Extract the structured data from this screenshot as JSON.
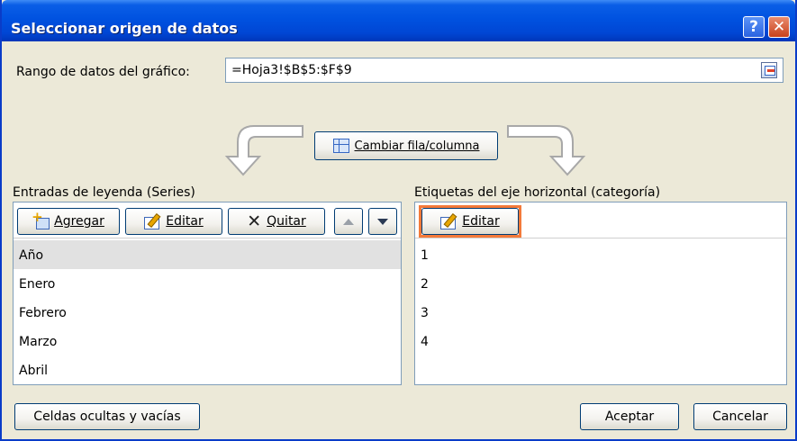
{
  "dialog": {
    "title": "Seleccionar origen de datos",
    "help_label": "?",
    "close_label": "✕",
    "range": {
      "label": "Rango de datos del gráfico:",
      "value": "=Hoja3!$B$5:$F$9"
    },
    "swap_button_label": "Cambiar fila/columna",
    "legend": {
      "label": "Entradas de leyenda (Series)",
      "buttons": {
        "add": "Agregar",
        "edit": "Editar",
        "remove": "Quitar"
      },
      "items": [
        "Año",
        "Enero",
        "Febrero",
        "Marzo",
        "Abril"
      ]
    },
    "axis": {
      "label": "Etiquetas del eje horizontal (categoría)",
      "edit_label": "Editar",
      "items": [
        "1",
        "2",
        "3",
        "4"
      ]
    },
    "hidden_cells_button": "Celdas ocultas y vacías",
    "ok_button": "Aceptar",
    "cancel_button": "Cancelar"
  },
  "colors": {
    "titlebar": "#0052e0",
    "highlight": "#f47a3a",
    "selected_row": "#e1e1e1"
  }
}
